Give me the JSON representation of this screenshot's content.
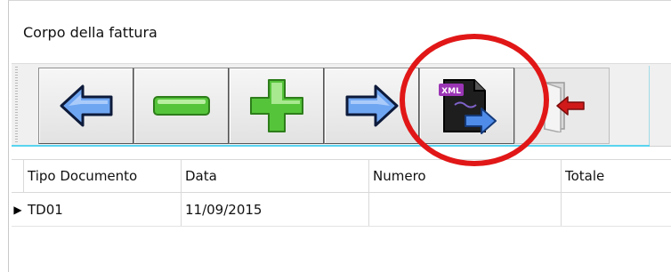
{
  "window": {
    "title": "Corpo della fattura"
  },
  "toolbar": {
    "buttons": [
      {
        "name": "previous",
        "icon": "arrow-left-icon",
        "color": "#3b7fe0"
      },
      {
        "name": "remove",
        "icon": "minus-icon",
        "color": "#4fbe2a"
      },
      {
        "name": "add",
        "icon": "plus-icon",
        "color": "#4fbe2a"
      },
      {
        "name": "next",
        "icon": "arrow-right-icon",
        "color": "#3b7fe0"
      },
      {
        "name": "export-xml",
        "icon": "xml-export-icon",
        "badge": "XML"
      },
      {
        "name": "exit",
        "icon": "door-exit-icon",
        "color": "#d01a1a"
      }
    ],
    "accent_color": "#58d4ef"
  },
  "annotation": {
    "color": "#e11717"
  },
  "grid": {
    "columns": [
      "Tipo Documento",
      "Data",
      "Numero",
      "Totale"
    ],
    "rows": [
      [
        "TD01",
        "11/09/2015",
        "",
        ""
      ]
    ],
    "current_row_marker": "▶"
  }
}
